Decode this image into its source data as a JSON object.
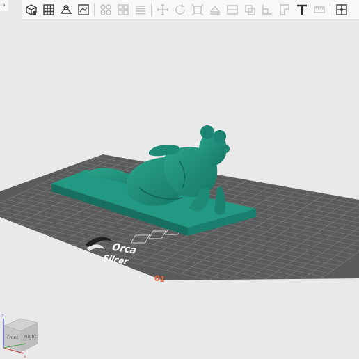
{
  "toolbar": {
    "collapse_glyph": "›",
    "buttons": [
      {
        "name": "add-cube-icon",
        "enabled": true
      },
      {
        "name": "arrange-grid-icon",
        "enabled": true
      },
      {
        "name": "orient-icon",
        "enabled": true
      },
      {
        "name": "plate-icon",
        "enabled": true
      },
      {
        "name": "split-objects-icon",
        "enabled": false
      },
      {
        "name": "split-parts-icon",
        "enabled": false
      },
      {
        "name": "layers-icon",
        "enabled": false
      },
      {
        "name": "move-icon",
        "enabled": false
      },
      {
        "name": "rotate-icon",
        "enabled": false
      },
      {
        "name": "scale-icon",
        "enabled": false
      },
      {
        "name": "lay-on-face-icon",
        "enabled": false
      },
      {
        "name": "cut-icon",
        "enabled": false
      },
      {
        "name": "support-paint-icon",
        "enabled": false
      },
      {
        "name": "seam-paint-icon",
        "enabled": false
      },
      {
        "name": "color-paint-icon",
        "enabled": false
      },
      {
        "name": "text-icon",
        "enabled": true
      },
      {
        "name": "measure-icon",
        "enabled": false
      },
      {
        "name": "assembly-icon",
        "enabled": true
      }
    ]
  },
  "plate": {
    "logo_line1": "Orca",
    "logo_line2": "Slicer",
    "plate_number": "01"
  },
  "view_cube": {
    "front_label": "Front",
    "right_label": "Right",
    "axis_z": "z",
    "axis_x": "x"
  },
  "colors": {
    "background": "#e9e9ea",
    "plate": "#5b5b5b",
    "grid_line": "#797979",
    "model": "#1f8f7a",
    "plate_number": "#e5633a"
  }
}
